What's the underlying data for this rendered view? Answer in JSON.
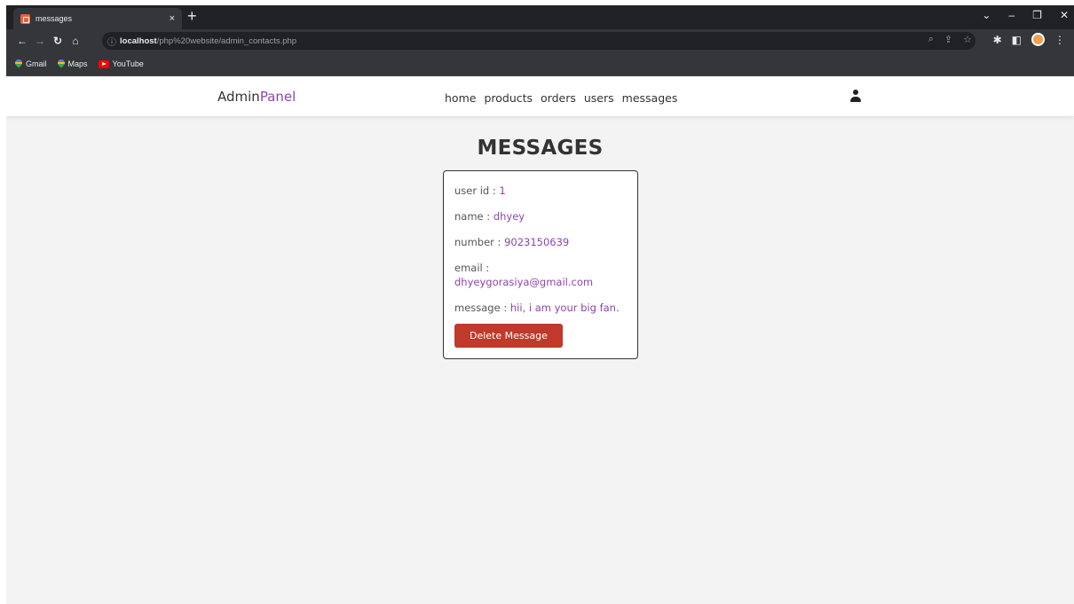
{
  "browser": {
    "tab_title": "messages",
    "tab_close": "×",
    "new_tab": "+",
    "url_host": "localhost",
    "url_path": "/php%20website/admin_contacts.php",
    "bookmarks": [
      "Gmail",
      "Maps",
      "YouTube"
    ]
  },
  "header": {
    "logo_main": "Admin",
    "logo_accent": "Panel",
    "nav": [
      "home",
      "products",
      "orders",
      "users",
      "messages"
    ]
  },
  "main": {
    "title": "MESSAGES",
    "message": {
      "user_id_label": "user id : ",
      "user_id": "1",
      "name_label": "name : ",
      "name": "dhyey",
      "number_label": "number : ",
      "number": "9023150639",
      "email_label": "email : ",
      "email": "dhyeygorasiya@gmail.com",
      "message_label": "message : ",
      "message": "hii, i am your big fan.",
      "delete_label": "Delete Message"
    }
  },
  "colors": {
    "accent": "#8e44ad",
    "danger": "#c0392b"
  }
}
